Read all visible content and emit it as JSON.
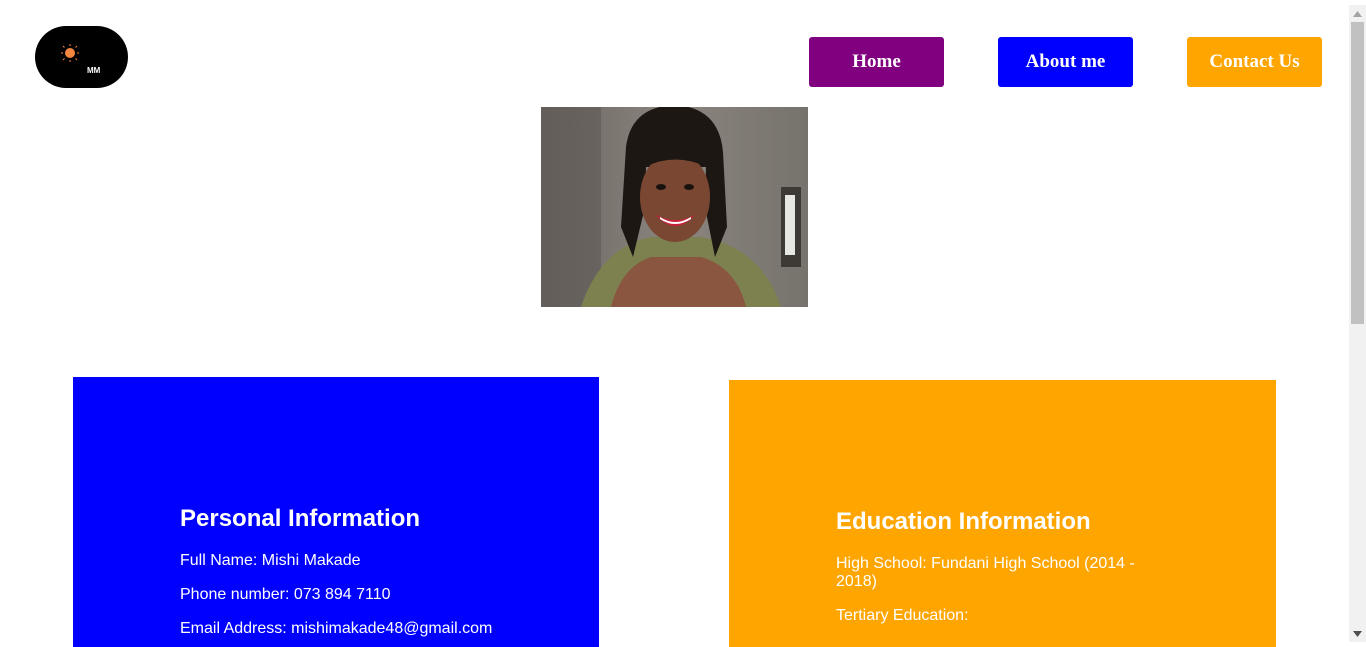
{
  "logo": {
    "initials": "MM"
  },
  "nav": {
    "home_label": "Home",
    "about_label": "About me",
    "contact_label": "Contact Us"
  },
  "colors": {
    "home": "#800080",
    "about": "#0000ff",
    "contact": "#ffa500",
    "personal_card": "#0000ff",
    "education_card": "#ffa500",
    "logo_sun": "#f4863f"
  },
  "personal": {
    "title": "Personal Information",
    "full_name": "Full Name: Mishi Makade",
    "phone": "Phone number: 073 894 7110",
    "email": "Email Address: mishimakade48@gmail.com"
  },
  "education": {
    "title": "Education Information",
    "high_school": "High School: Fundani High School (2014 - 2018)",
    "tertiary": "Tertiary Education:"
  }
}
